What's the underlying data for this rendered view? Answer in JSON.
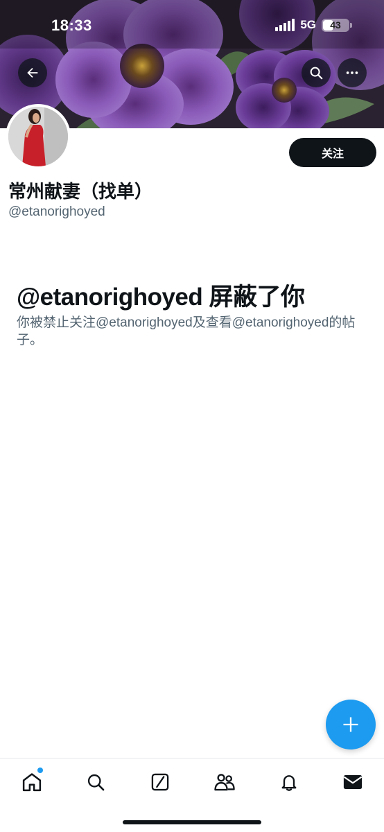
{
  "status_bar": {
    "time": "18:33",
    "network": "5G",
    "battery": "43",
    "battery_level": 0.43,
    "signal_icon": "cellular-signal-icon"
  },
  "header": {
    "back_icon": "arrow-left-icon",
    "search_icon": "search-icon",
    "more_icon": "more-horizontal-icon",
    "banner": "purple-petunia-flowers"
  },
  "profile": {
    "display_name": "常州献妻（找单）",
    "handle": "@etanorighoyed",
    "follow_label": "关注",
    "avatar": "woman-in-red-dress"
  },
  "blocked": {
    "title": "@etanorighoyed 屏蔽了你",
    "description": "你被禁止关注@etanorighoyed及查看@etanorighoyed的帖子。"
  },
  "fab": {
    "icon": "plus-icon"
  },
  "bottom_nav": {
    "items": [
      "home-icon",
      "search-icon",
      "grok-icon",
      "communities-icon",
      "notifications-icon",
      "messages-icon"
    ],
    "home_has_notification": true
  },
  "colors": {
    "accent": "#1d9bf0",
    "text_primary": "#0f1419",
    "text_secondary": "#536471",
    "button_dark": "#0f1419"
  }
}
